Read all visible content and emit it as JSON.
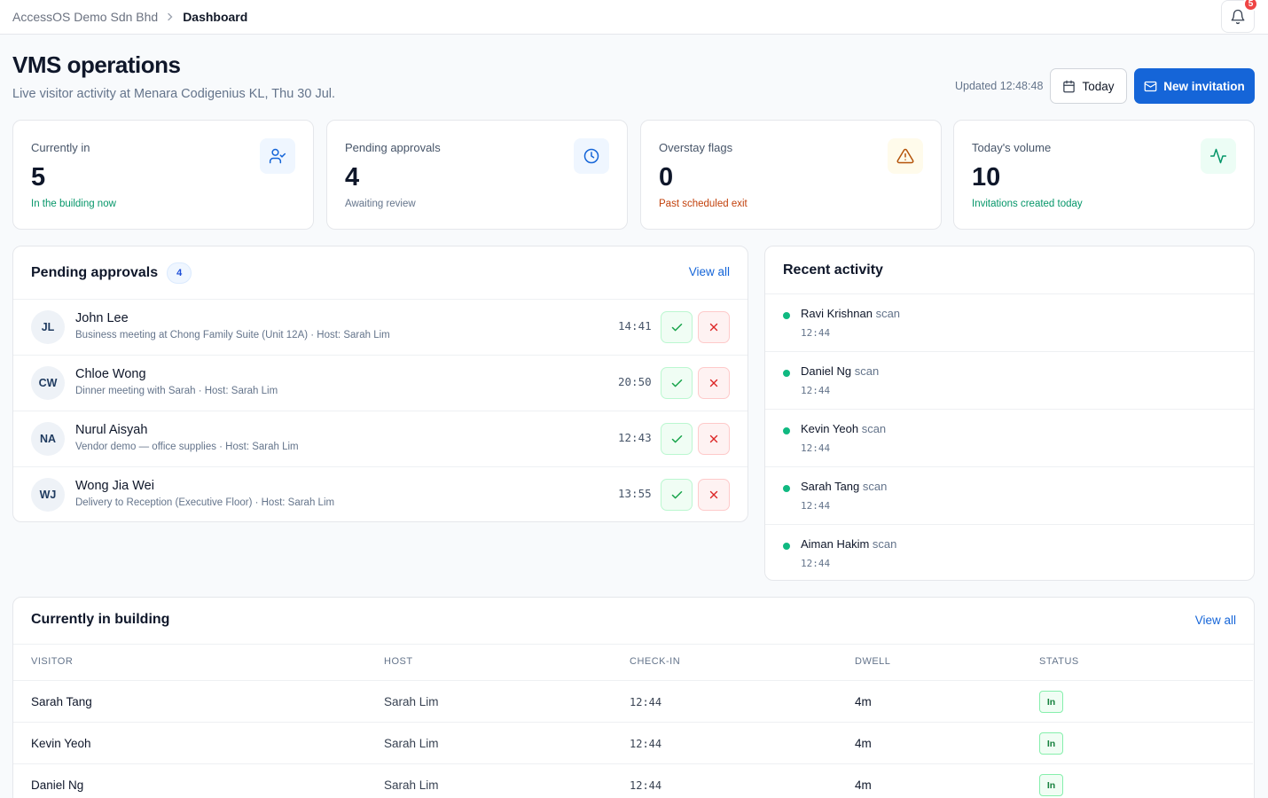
{
  "breadcrumb": {
    "org": "AccessOS Demo Sdn Bhd",
    "current": "Dashboard"
  },
  "notifications": {
    "count": "5"
  },
  "header": {
    "title": "VMS operations",
    "subtitle": "Live visitor activity at Menara Codigenius KL, Thu 30 Jul.",
    "updated": "Updated 12:48:48",
    "today_label": "Today",
    "new_invitation_label": "New invitation"
  },
  "stats": [
    {
      "label": "Currently in",
      "value": "5",
      "note": "In the building now",
      "note_color": "#059669",
      "icon": "user-check-icon"
    },
    {
      "label": "Pending approvals",
      "value": "4",
      "note": "Awaiting review",
      "note_color": "#64748b",
      "icon": "clock-icon"
    },
    {
      "label": "Overstay flags",
      "value": "0",
      "note": "Past scheduled exit",
      "note_color": "#c2410c",
      "icon": "warning-icon"
    },
    {
      "label": "Today's volume",
      "value": "10",
      "note": "Invitations created today",
      "note_color": "#059669",
      "icon": "activity-icon"
    }
  ],
  "pending": {
    "title": "Pending approvals",
    "count": "4",
    "view_all": "View all",
    "items": [
      {
        "initials": "JL",
        "name": "John Lee",
        "desc": "Business meeting at Chong Family Suite (Unit 12A) · Host: Sarah Lim",
        "time": "14:41"
      },
      {
        "initials": "CW",
        "name": "Chloe Wong",
        "desc": "Dinner meeting with Sarah · Host: Sarah Lim",
        "time": "20:50"
      },
      {
        "initials": "NA",
        "name": "Nurul Aisyah",
        "desc": "Vendor demo — office supplies · Host: Sarah Lim",
        "time": "12:43"
      },
      {
        "initials": "WJ",
        "name": "Wong Jia Wei",
        "desc": "Delivery to Reception (Executive Floor) · Host: Sarah Lim",
        "time": "13:55"
      }
    ]
  },
  "activity": {
    "title": "Recent activity",
    "items": [
      {
        "name": "Ravi Krishnan",
        "type": "scan",
        "time": "12:44"
      },
      {
        "name": "Daniel Ng",
        "type": "scan",
        "time": "12:44"
      },
      {
        "name": "Kevin Yeoh",
        "type": "scan",
        "time": "12:44"
      },
      {
        "name": "Sarah Tang",
        "type": "scan",
        "time": "12:44"
      },
      {
        "name": "Aiman Hakim",
        "type": "scan",
        "time": "12:44"
      }
    ]
  },
  "building": {
    "title": "Currently in building",
    "view_all": "View all",
    "columns": [
      "Visitor",
      "Host",
      "Check-in",
      "Dwell",
      "Status"
    ],
    "rows": [
      {
        "visitor": "Sarah Tang",
        "host": "Sarah Lim",
        "checkin": "12:44",
        "dwell": "4m",
        "status": "In"
      },
      {
        "visitor": "Kevin Yeoh",
        "host": "Sarah Lim",
        "checkin": "12:44",
        "dwell": "4m",
        "status": "In"
      },
      {
        "visitor": "Daniel Ng",
        "host": "Sarah Lim",
        "checkin": "12:44",
        "dwell": "4m",
        "status": "In"
      }
    ]
  },
  "colors": {
    "accent": "#1565d8",
    "success": "#10b981",
    "danger": "#ef4444",
    "warning": "#c2410c"
  }
}
